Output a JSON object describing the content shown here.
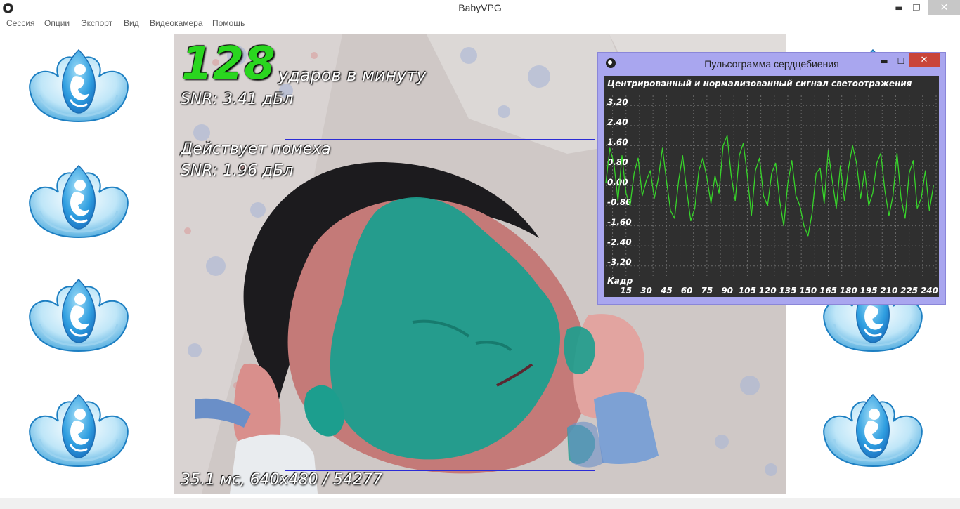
{
  "window": {
    "title": "BabyVPG",
    "minimize": "▬",
    "restore": "❐",
    "close": "✕"
  },
  "menu": [
    "Сессия",
    "Опции",
    "Экспорт",
    "Вид",
    "Видеокамера",
    "Помощь"
  ],
  "video": {
    "bpm_value": "128",
    "bpm_unit": "ударов в минуту",
    "snr_primary": "SNR: 3.41 дБл",
    "warning": "Действует помеха",
    "snr_secondary": "SNR: 1.96 дБл",
    "footer": "35.1 мс, 640x480 / 54277"
  },
  "pulse_window": {
    "title": "Пульсограмма сердцебиения",
    "minimize": "▬",
    "maximize": "☐",
    "close": "✕"
  },
  "chart_data": {
    "type": "line",
    "title": "Центрированный и нормализованный сигнал светоотражения",
    "xlabel": "Кадр",
    "ylabel": "",
    "xlim": [
      0,
      245
    ],
    "ylim": [
      -3.6,
      3.6
    ],
    "x_ticks": [
      15,
      30,
      45,
      60,
      75,
      90,
      105,
      120,
      135,
      150,
      165,
      180,
      195,
      210,
      225,
      240
    ],
    "y_ticks": [
      3.2,
      2.4,
      1.6,
      0.8,
      0.0,
      -0.8,
      -1.6,
      -2.4,
      -3.2
    ],
    "y_tick_labels": [
      "3.20",
      "2.40",
      "1.60",
      "0.80",
      "0.00",
      "-0.80",
      "-1.60",
      "-2.40",
      "-3.20"
    ],
    "grid": true,
    "line_color": "#37d42a",
    "background": "#2f2f2f",
    "series": [
      {
        "x": [
          0,
          3,
          6,
          9,
          12,
          15,
          18,
          21,
          24,
          27,
          30,
          33,
          36,
          39,
          42,
          45,
          48,
          51,
          54,
          57,
          60,
          63,
          66,
          69,
          72,
          75,
          78,
          81,
          84,
          87,
          90,
          93,
          96,
          99,
          102,
          105,
          108,
          111,
          114,
          117,
          120,
          123,
          126,
          129,
          132,
          135,
          138,
          141,
          144,
          147,
          150,
          153,
          156,
          159,
          162,
          165,
          168,
          171,
          174,
          177,
          180,
          183,
          186,
          189,
          192,
          195,
          198,
          201,
          204,
          207,
          210,
          213,
          216,
          219,
          222,
          225,
          228,
          231,
          234,
          237,
          240,
          243
        ],
        "y": [
          0.1,
          1.5,
          0.9,
          -0.6,
          1.2,
          -0.3,
          -0.8,
          0.5,
          1.1,
          -0.4,
          0.2,
          0.6,
          -0.5,
          0.3,
          1.5,
          0.2,
          -1.0,
          -1.3,
          0.2,
          1.2,
          -0.2,
          -1.4,
          -0.9,
          0.6,
          1.1,
          0.3,
          -0.7,
          0.4,
          -0.3,
          1.6,
          2.0,
          0.4,
          -0.6,
          1.2,
          1.7,
          0.4,
          -1.2,
          0.6,
          1.1,
          -0.4,
          -0.8,
          0.5,
          0.9,
          -0.6,
          -1.6,
          0.1,
          1.0,
          -0.4,
          -0.8,
          -1.6,
          -2.0,
          -1.1,
          0.5,
          0.7,
          -0.7,
          1.4,
          0.2,
          -0.9,
          0.8,
          -0.6,
          0.7,
          1.6,
          0.9,
          -0.5,
          0.6,
          -0.8,
          -0.3,
          0.9,
          1.3,
          -0.2,
          -1.2,
          -0.4,
          1.3,
          -0.5,
          -1.3,
          0.5,
          1.0,
          -0.9,
          -0.5,
          0.6,
          -1.0,
          0.0
        ]
      }
    ]
  },
  "icons": {
    "app": "app-logo-icon",
    "logo": "baby-vpg-logo"
  }
}
